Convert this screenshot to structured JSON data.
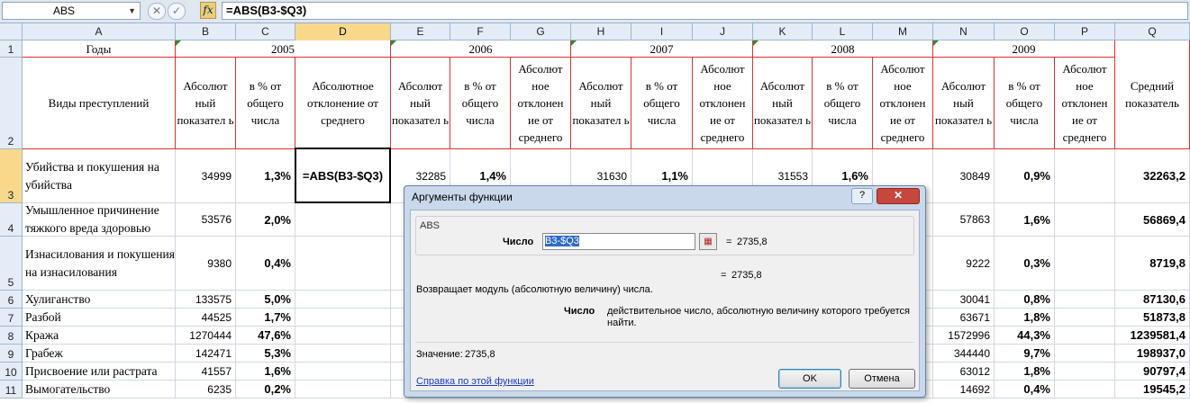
{
  "formula_bar": {
    "name_box": "ABS",
    "name_box_arrow": "▼",
    "cancel_symbol": "✕",
    "enter_symbol": "✓",
    "fx_symbol": "fx",
    "formula": "=ABS(B3-$Q3)"
  },
  "columns": [
    "A",
    "B",
    "C",
    "D",
    "E",
    "F",
    "G",
    "H",
    "I",
    "J",
    "K",
    "L",
    "M",
    "N",
    "O",
    "P",
    "Q"
  ],
  "rows": [
    "1",
    "2",
    "3",
    "4",
    "5",
    "6",
    "7",
    "8",
    "9",
    "10",
    "11"
  ],
  "header": {
    "years_label": "Годы",
    "crime_types_label": "Виды преступлений",
    "years": [
      "2005",
      "2006",
      "2007",
      "2008",
      "2009"
    ],
    "abs_label": "Абсолют ный показател ь",
    "abs_label_short": "Абсолют ный показател ь",
    "pct_label": "в % от общего числа",
    "dev_label_d": "Абсолютное отклонение от среднего",
    "dev_label": "Абсолют ное отклонен ие от среднего",
    "avg_label": "Средний показатель"
  },
  "table_rows": [
    {
      "name": "Убийства и покушения на убийства",
      "b": "34999",
      "c": "1,3%",
      "d": "=ABS(B3-$Q3)",
      "e": "32285",
      "f": "1,4%",
      "h": "31630",
      "i": "1,1%",
      "k": "31553",
      "l": "1,6%",
      "n": "30849",
      "o": "0,9%",
      "q": "32263,2"
    },
    {
      "name": "Умышленное причинение тяжкого вреда здоровью",
      "b": "53576",
      "c": "2,0%",
      "n": "57863",
      "o": "1,6%",
      "q": "56869,4"
    },
    {
      "name": "Изнасилования и покушения на изнасилования",
      "b": "9380",
      "c": "0,4%",
      "n": "9222",
      "o": "0,3%",
      "q": "8719,8"
    },
    {
      "name": "Хулиганство",
      "b": "133575",
      "c": "5,0%",
      "n": "30041",
      "o": "0,8%",
      "q": "87130,6"
    },
    {
      "name": "Разбой",
      "b": "44525",
      "c": "1,7%",
      "n": "63671",
      "o": "1,8%",
      "q": "51873,8"
    },
    {
      "name": "Кража",
      "b": "1270444",
      "c": "47,6%",
      "n": "1572996",
      "o": "44,3%",
      "q": "1239581,4"
    },
    {
      "name": "Грабеж",
      "b": "142471",
      "c": "5,3%",
      "n": "344440",
      "o": "9,7%",
      "q": "198937,0"
    },
    {
      "name": "Присвоение или растрата",
      "b": "41557",
      "c": "1,6%",
      "n": "63012",
      "o": "1,8%",
      "q": "90797,4"
    },
    {
      "name": "Вымогательство",
      "b": "6235",
      "c": "0,2%",
      "n": "14692",
      "o": "0,4%",
      "q": "19545,2"
    }
  ],
  "dialog": {
    "title": "Аргументы функции",
    "help_symbol": "?",
    "close_symbol": "✕",
    "function_name": "ABS",
    "arg_label": "Число",
    "arg_value": "B3-$Q3",
    "ref_symbol": "▦",
    "eq": "=",
    "arg_result": "2735,8",
    "formula_result": "2735,8",
    "description": "Возвращает модуль (абсолютную величину) числа.",
    "arg_desc_name": "Число",
    "arg_desc": "действительное число, абсолютную величину которого требуется найти.",
    "value_label": "Значение:",
    "value": "2735,8",
    "help_link": "Справка по этой функции",
    "ok": "OK",
    "cancel": "Отмена"
  }
}
